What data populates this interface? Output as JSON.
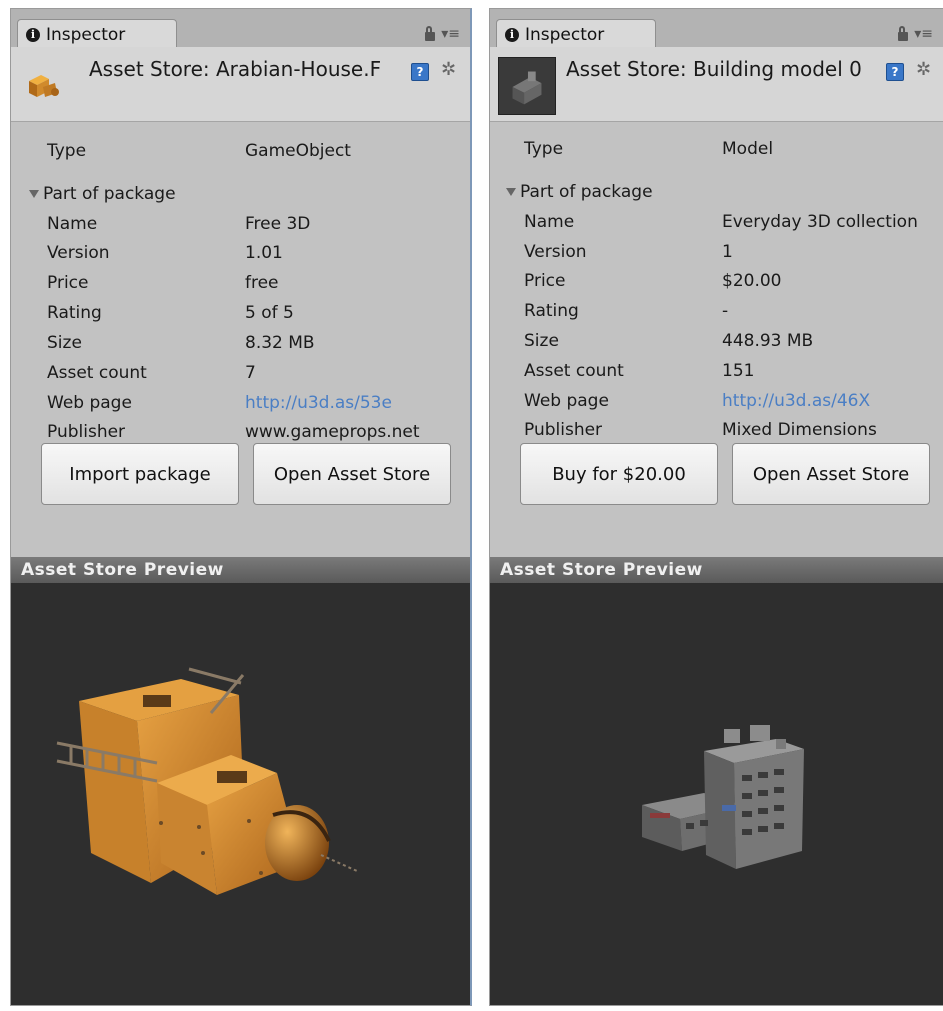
{
  "panels": [
    {
      "tab_title": "Inspector",
      "header_title": "Asset Store: Arabian-House.F",
      "type_label": "Type",
      "type_value": "GameObject",
      "section_label": "Part of package",
      "rows": [
        {
          "label": "Name",
          "value": "Free 3D"
        },
        {
          "label": "Version",
          "value": "1.01"
        },
        {
          "label": "Price",
          "value": "free"
        },
        {
          "label": "Rating",
          "value": "5 of 5"
        },
        {
          "label": "Size",
          "value": "8.32 MB"
        },
        {
          "label": "Asset count",
          "value": "7"
        },
        {
          "label": "Web page",
          "value": "http://u3d.as/53e"
        },
        {
          "label": "Publisher",
          "value": "www.gameprops.net"
        }
      ],
      "button1": "Import package",
      "button2": "Open Asset Store",
      "preview_title": "Asset Store Preview"
    },
    {
      "tab_title": "Inspector",
      "header_title": "Asset Store: Building model 0",
      "type_label": "Type",
      "type_value": "Model",
      "section_label": "Part of package",
      "rows": [
        {
          "label": "Name",
          "value": "Everyday 3D collection"
        },
        {
          "label": "Version",
          "value": "1"
        },
        {
          "label": "Price",
          "value": "$20.00"
        },
        {
          "label": "Rating",
          "value": "-"
        },
        {
          "label": "Size",
          "value": "448.93 MB"
        },
        {
          "label": "Asset count",
          "value": "151"
        },
        {
          "label": "Web page",
          "value": "http://u3d.as/46X"
        },
        {
          "label": "Publisher",
          "value": "Mixed Dimensions"
        }
      ],
      "button1": "Buy for $20.00",
      "button2": "Open Asset Store",
      "preview_title": "Asset Store Preview"
    }
  ],
  "colors": {
    "link": "#4a7ec4",
    "panel_bg": "#c2c2c2",
    "preview_bg": "#2e2e2e",
    "asset_orange": "#d08a2c"
  }
}
